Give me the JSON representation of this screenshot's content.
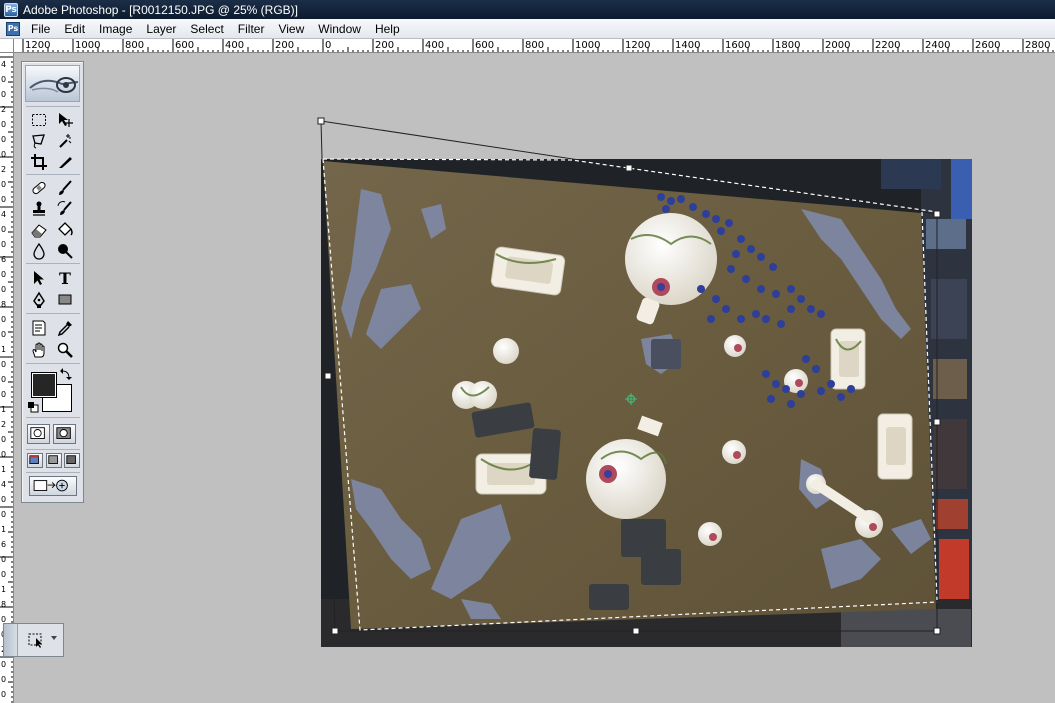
{
  "window": {
    "title": "Adobe Photoshop - [R0012150.JPG @ 25% (RGB)]"
  },
  "menu": {
    "items": [
      "File",
      "Edit",
      "Image",
      "Layer",
      "Select",
      "Filter",
      "View",
      "Window",
      "Help"
    ]
  },
  "ruler": {
    "top_labels": [
      "1200",
      "1000",
      "800",
      "600",
      "400",
      "200",
      "0",
      "200",
      "400",
      "600",
      "800",
      "1000",
      "1200",
      "1400",
      "1600",
      "1800",
      "2000",
      "2200",
      "2400",
      "2600",
      "2800"
    ],
    "left_labels": [
      "4",
      "0",
      "0",
      "2",
      "0",
      "0",
      "0",
      "2",
      "0",
      "0",
      "4",
      "0",
      "0",
      "6",
      "0",
      "0",
      "8",
      "0",
      "0",
      "1",
      "0",
      "0",
      "0",
      "1",
      "2",
      "0",
      "0",
      "1",
      "4",
      "0",
      "0",
      "1",
      "6",
      "0",
      "0",
      "1",
      "8",
      "0",
      "0",
      "2",
      "0",
      "0",
      "0"
    ]
  },
  "tools": {
    "items": [
      {
        "name": "marquee-tool",
        "icon": "marquee-icon"
      },
      {
        "name": "move-tool",
        "icon": "move-icon"
      },
      {
        "name": "lasso-tool",
        "icon": "lasso-icon"
      },
      {
        "name": "magic-wand-tool",
        "icon": "magic-wand-icon"
      },
      {
        "name": "crop-tool",
        "icon": "crop-icon"
      },
      {
        "name": "slice-tool",
        "icon": "slice-icon"
      },
      {
        "name": "healing-brush-tool",
        "icon": "bandage-icon"
      },
      {
        "name": "brush-tool",
        "icon": "brush-icon"
      },
      {
        "name": "clone-stamp-tool",
        "icon": "stamp-icon"
      },
      {
        "name": "history-brush-tool",
        "icon": "history-brush-icon"
      },
      {
        "name": "eraser-tool",
        "icon": "eraser-icon"
      },
      {
        "name": "paint-bucket-tool",
        "icon": "bucket-icon"
      },
      {
        "name": "blur-tool",
        "icon": "drop-icon"
      },
      {
        "name": "dodge-tool",
        "icon": "dodge-icon"
      },
      {
        "name": "path-selection-tool",
        "icon": "arrow-icon"
      },
      {
        "name": "type-tool",
        "icon": "type-icon"
      },
      {
        "name": "pen-tool",
        "icon": "pen-icon"
      },
      {
        "name": "shape-tool",
        "icon": "rectangle-icon"
      },
      {
        "name": "notes-tool",
        "icon": "notes-icon"
      },
      {
        "name": "eyedropper-tool",
        "icon": "eyedropper-icon"
      },
      {
        "name": "hand-tool",
        "icon": "hand-icon"
      },
      {
        "name": "zoom-tool",
        "icon": "zoom-icon"
      }
    ],
    "type_glyph": "T",
    "foreground_color": "#262626",
    "background_color": "#ffffff"
  },
  "colors": {
    "titlebar": "#0c1a2e",
    "workspace": "#c0c0c0",
    "table_felt": "#6b5e3f",
    "terrain_rock": "#7f8aa8",
    "building": "#f2eee4",
    "infantry_blue": "#2e3f9a",
    "tank_gray": "#3a3d42"
  }
}
